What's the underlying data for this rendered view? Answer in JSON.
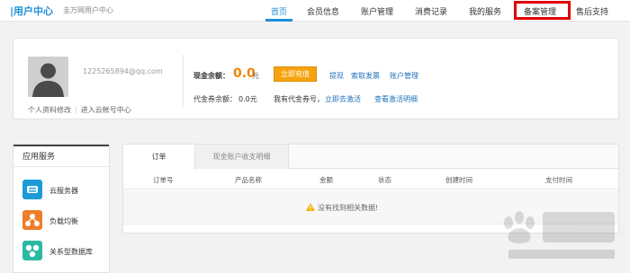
{
  "header": {
    "brand": "|用户中心",
    "brand_sub": "圭万网用户中心",
    "nav": [
      {
        "label": "首页",
        "active": true
      },
      {
        "label": "会员信息",
        "active": false
      },
      {
        "label": "账户管理",
        "active": false
      },
      {
        "label": "消费记录",
        "active": false
      },
      {
        "label": "我的服务",
        "active": false
      },
      {
        "label": "备案管理",
        "active": false,
        "highlighted": true
      },
      {
        "label": "售后支持",
        "active": false
      }
    ]
  },
  "profile": {
    "email": "1225265894@qq.com",
    "edit_profile": "个人资料修改",
    "separator": "|",
    "cloud_account": "进入云帐号中心",
    "cash_label": "现金余额：",
    "cash_amount": "0.0",
    "cash_unit": "元",
    "recharge_button": "立即充值",
    "withdraw": "提现",
    "invoice": "索取发票",
    "account_manage": "账户管理",
    "voucher_label": "代金券余额：",
    "voucher_amount": "0.0元",
    "voucher_question": "我有代金券号，",
    "activate_now": "立即去激活",
    "view_details": "查看激活明细"
  },
  "sidebar": {
    "title": "应用服务",
    "items": [
      {
        "label": "云服务器",
        "icon": "cloud-server-icon",
        "color": "#1c9bd6"
      },
      {
        "label": "负载均衡",
        "icon": "load-balance-icon",
        "color": "#ef7d2a"
      },
      {
        "label": "关系型数据库",
        "icon": "database-icon",
        "color": "#2bb9a4"
      }
    ]
  },
  "main": {
    "tabs": [
      {
        "label": "订单",
        "active": true
      },
      {
        "label": "现金账户收支明细",
        "active": false
      }
    ],
    "columns": [
      "订单号",
      "产品名称",
      "金额",
      "状态",
      "创建时间",
      "支付时间"
    ],
    "empty_message": "没有找到相关数据!"
  },
  "colors": {
    "accent": "#1d8ed8",
    "highlight_box": "#e00000",
    "cash": "#f08200",
    "button": "#f4a30e"
  }
}
